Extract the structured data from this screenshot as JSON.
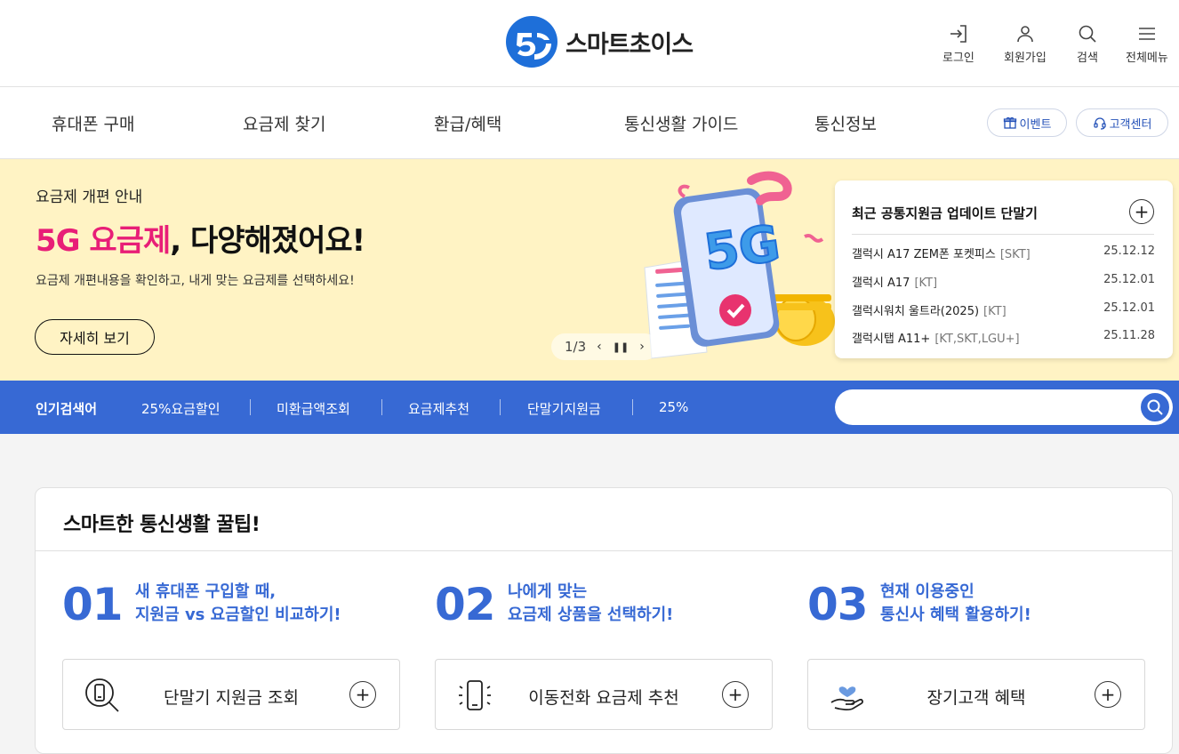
{
  "header": {
    "logo_text": "스마트초이스",
    "utils": [
      {
        "label": "로그인",
        "icon": "login-icon"
      },
      {
        "label": "회원가입",
        "icon": "user-icon"
      },
      {
        "label": "검색",
        "icon": "search-icon"
      },
      {
        "label": "전체메뉴",
        "icon": "menu-icon"
      }
    ]
  },
  "nav": {
    "items": [
      "휴대폰 구매",
      "요금제 찾기",
      "환급/혜택",
      "통신생활 가이드",
      "통신정보"
    ],
    "event_label": "이벤트",
    "support_label": "고객센터"
  },
  "banner": {
    "kicker": "요금제 개편 안내",
    "title_highlight": "5G 요금제",
    "title_rest": ", 다양해졌어요!",
    "desc": "요금제 개편내용을 확인하고, 내게 맞는 요금제를 선택하세요!",
    "button": "자세히 보기",
    "pager": "1/3",
    "illust_text": "5G"
  },
  "updates": {
    "title": "최근 공통지원금 업데이트 단말기",
    "rows": [
      {
        "name": "갤럭시 A17 ZEM폰 포켓피스",
        "carrier": "[SKT]",
        "date": "25.12.12"
      },
      {
        "name": "갤럭시 A17",
        "carrier": "[KT]",
        "date": "25.12.01"
      },
      {
        "name": "갤럭시워치 울트라(2025)",
        "carrier": "[KT]",
        "date": "25.12.01"
      },
      {
        "name": "갤럭시탭 A11+",
        "carrier": "[KT,SKT,LGU+]",
        "date": "25.11.28"
      }
    ]
  },
  "popular": {
    "label": "인기검색어",
    "keywords": [
      "25%요금할인",
      "미환급액조회",
      "요금제추천",
      "단말기지원금",
      "25%"
    ],
    "search_value": ""
  },
  "tips": {
    "title": "스마트한 통신생활 꿀팁!",
    "items": [
      {
        "num": "01",
        "line1": "새 휴대폰 구입할 때,",
        "line2": "지원금 vs 요금할인 비교하기!",
        "card": "단말기 지원금 조회",
        "icon": "phone-search-icon"
      },
      {
        "num": "02",
        "line1": "나에게 맞는",
        "line2": "요금제 상품을 선택하기!",
        "card": "이동전화 요금제 추천",
        "icon": "phone-vibrate-icon"
      },
      {
        "num": "03",
        "line1": "현재 이용중인",
        "line2": "통신사 혜택 활용하기!",
        "card": "장기고객 혜택",
        "icon": "heart-hand-icon"
      }
    ]
  },
  "colors": {
    "accent": "#3769d4",
    "pink": "#e81e77",
    "banner_bg": "#fff3c4"
  }
}
